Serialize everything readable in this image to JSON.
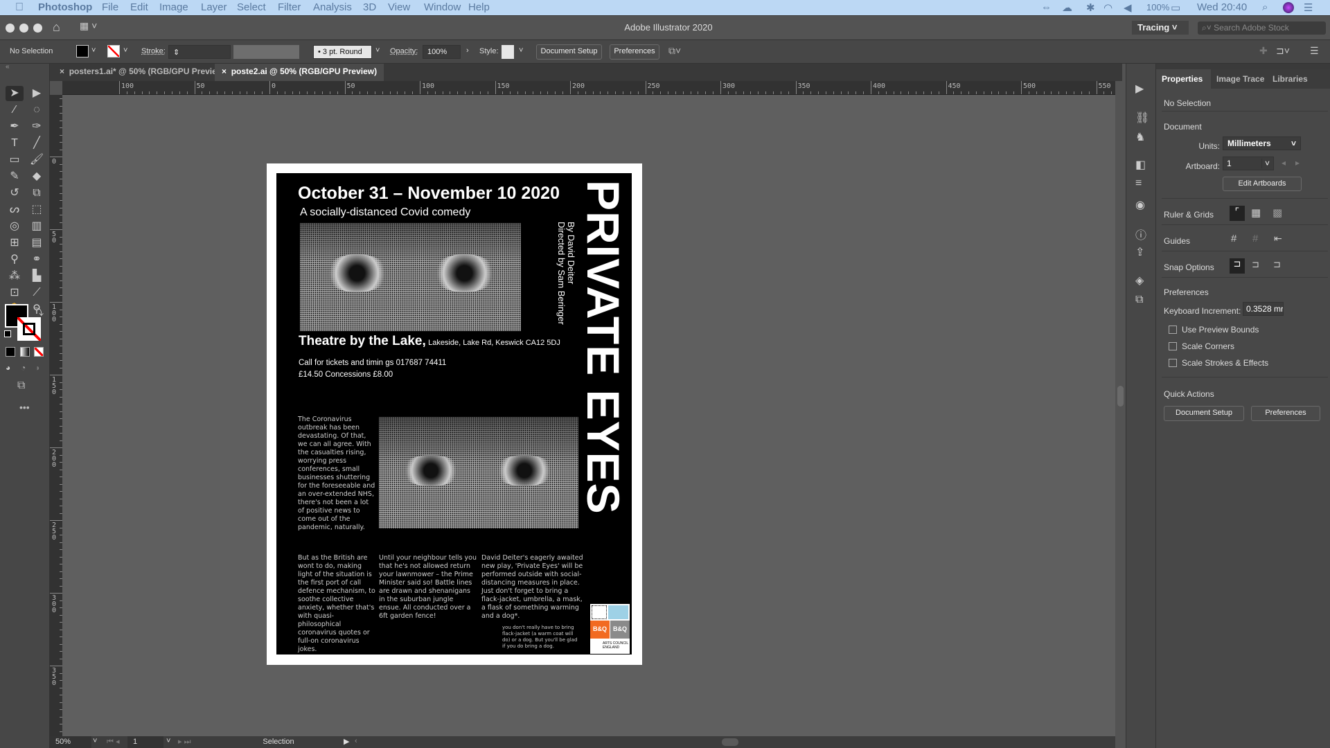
{
  "menubar": {
    "apple": "",
    "app": "Photoshop",
    "items": [
      "File",
      "Edit",
      "Image",
      "Layer",
      "Select",
      "Filter",
      "Analysis",
      "3D",
      "View",
      "Window",
      "Help"
    ],
    "battery": "100%",
    "clock": "Wed 20:40"
  },
  "titlebar": {
    "title": "Adobe Illustrator 2020",
    "workspace": "Tracing",
    "search_placeholder": "Search Adobe Stock"
  },
  "control": {
    "selection": "No Selection",
    "stroke_label": "Stroke:",
    "brush": "3 pt. Round",
    "opacity_label": "Opacity:",
    "opacity": "100%",
    "style_label": "Style:",
    "document_setup": "Document Setup",
    "preferences": "Preferences",
    "fill_color": "#000000"
  },
  "tabs": [
    {
      "label": "posters1.ai* @ 50% (RGB/GPU Preview)",
      "active": false
    },
    {
      "label": "poste2.ai @ 50% (RGB/GPU Preview)",
      "active": true
    }
  ],
  "rulers": {
    "h_labels": [
      "100",
      "50",
      "0",
      "50",
      "100",
      "150",
      "200",
      "250",
      "300",
      "350",
      "400",
      "450",
      "500",
      "550"
    ],
    "v_labels": [
      "0",
      "50",
      "100",
      "150",
      "200",
      "250",
      "300",
      "350"
    ]
  },
  "tools": [
    "selection-icon",
    "direct-selection-icon",
    "magic-wand-icon",
    "lasso-icon",
    "pen-icon",
    "curvature-icon",
    "type-icon",
    "line-icon",
    "rectangle-icon",
    "paintbrush-icon",
    "pencil-icon",
    "eraser-icon",
    "rotate-icon",
    "scale-icon",
    "warp-icon",
    "free-transform-icon",
    "shape-builder-icon",
    "perspective-grid-icon",
    "mesh-icon",
    "gradient-icon",
    "eyedropper-icon",
    "blend-icon",
    "symbol-sprayer-icon",
    "column-graph-icon",
    "artboard-icon",
    "slice-icon",
    "hand-icon",
    "zoom-icon"
  ],
  "poster": {
    "dates": "October 31 – November 10 2020",
    "tagline": "A socially-distanced Covid comedy",
    "title": "PRIVATE EYES",
    "credit1": "By David Deiter",
    "credit2": "Directed by Sam Beringer",
    "venue": "Theatre by the Lake,",
    "address": "Lakeside, Lake Rd, Keswick CA12 5DJ",
    "tickets": "Call for tickets and timin gs 017687 74411",
    "prices": "£14.50 Concessions £8.00",
    "para1": "The Coronavirus outbreak has been devastating. Of that, we can all agree. With the casualties rising, worrying press conferences, small businesses shuttering for the foreseeable and an over-extended NHS, there's not been a lot of positive news to come out of the pandemic, naturally.",
    "para2": "But as the British are wont to do, making light of the situation is the first port of call defence mechanism, to soothe collective anxiety, whether that's with quasi-philosophical coronavirus quotes or full-on coronavirus jokes.",
    "para3": "Until your neighbour tells you that he's not allowed return your lawnmower – the Prime Minister said so! Battle lines are drawn and shenanigans in the suburban jungle ensue. All conducted over a 6ft garden fence!",
    "para4": "David Deiter's eagerly awaited new play, 'Private Eyes' will be performed outside with social-distancing measures in place. Just don't forget to bring a flack-jacket, umbrella, a mask, a flask of something warming and a dog*.",
    "footnote": "you don't really have to bring flack-jacket (a warm coat will do) or a dog. But you'll be glad if you do bring a dog.",
    "logo_bq": "B&Q",
    "logo_arts": "ARTS COUNCIL ENGLAND",
    "logo_bq_color": "#f26a21"
  },
  "panel": {
    "tabs": [
      "Properties",
      "Image Trace",
      "Libraries"
    ],
    "no_selection": "No Selection",
    "document": "Document",
    "units_label": "Units:",
    "units": "Millimeters",
    "artboard_label": "Artboard:",
    "artboard": "1",
    "edit_artboards": "Edit Artboards",
    "ruler_grids": "Ruler & Grids",
    "guides": "Guides",
    "snap": "Snap Options",
    "preferences": "Preferences",
    "kbd_label": "Keyboard Increment:",
    "kbd_value": "0.3528 mr",
    "checks": [
      {
        "label": "Use Preview Bounds",
        "checked": false
      },
      {
        "label": "Scale Corners",
        "checked": false
      },
      {
        "label": "Scale Strokes & Effects",
        "checked": false
      }
    ],
    "quick_actions": "Quick Actions",
    "qa_doc_setup": "Document Setup",
    "qa_prefs": "Preferences"
  },
  "status": {
    "zoom": "50%",
    "artboard": "1",
    "tool": "Selection"
  }
}
